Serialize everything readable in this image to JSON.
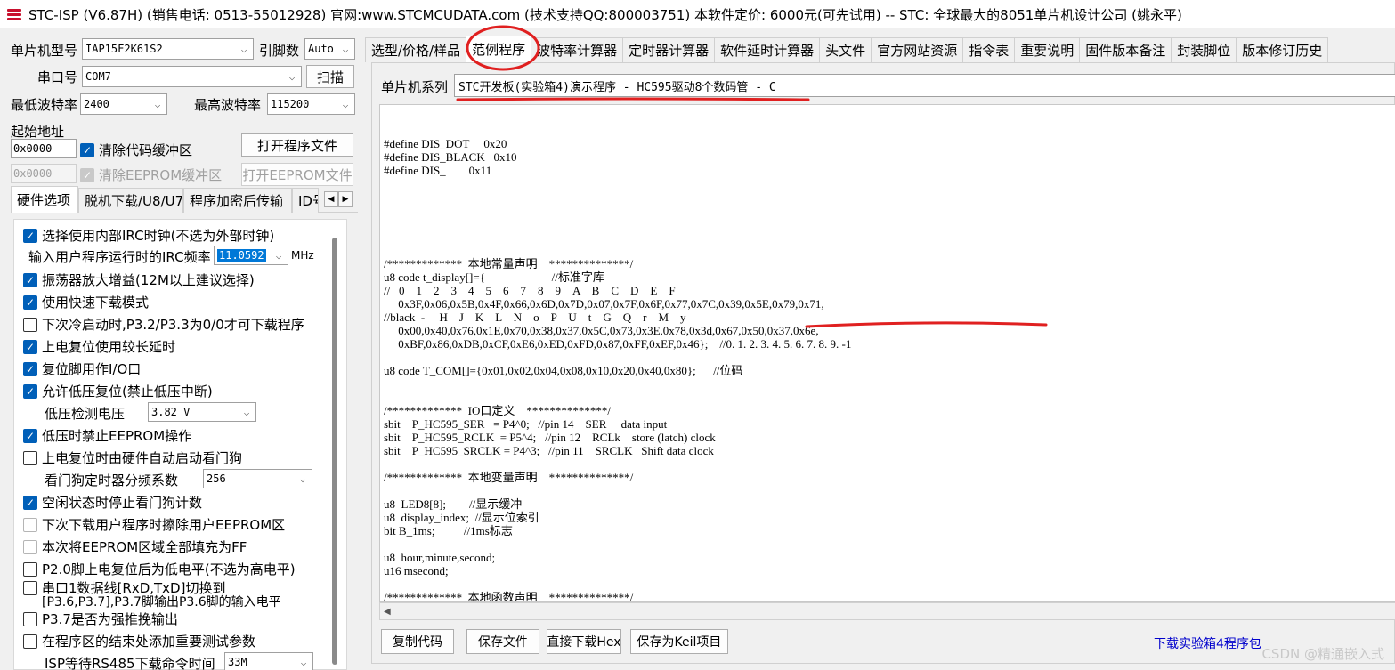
{
  "window": {
    "title": "STC-ISP (V6.87H) (销售电话: 0513-55012928) 官网:www.STCMCUDATA.com  (技术支持QQ:800003751) 本软件定价: 6000元(可先试用) -- STC: 全球最大的8051单片机设计公司 (姚永平)"
  },
  "left": {
    "mcu_model_label": "单片机型号",
    "mcu_model_value": "IAP15F2K61S2",
    "pin_count_label": "引脚数",
    "pin_count_value": "Auto",
    "port_label": "串口号",
    "port_value": "COM7",
    "scan_button": "扫描",
    "min_baud_label": "最低波特率",
    "min_baud_value": "2400",
    "max_baud_label": "最高波特率",
    "max_baud_value": "115200",
    "start_addr_label": "起始地址",
    "code_addr_value": "0x0000",
    "clear_code_buffer": "清除代码缓冲区",
    "open_program_button": "打开程序文件",
    "eeprom_addr_value": "0x0000",
    "clear_eeprom_buffer": "清除EEPROM缓冲区",
    "open_eeprom_button": "打开EEPROM文件",
    "tabs": [
      "硬件选项",
      "脱机下载/U8/U7",
      "程序加密后传输",
      "ID号"
    ],
    "options": {
      "internal_irc": "选择使用内部IRC时钟(不选为外部时钟)",
      "irc_freq_label": "输入用户程序运行时的IRC频率",
      "irc_freq_value": "11.0592",
      "irc_freq_unit": "MHz",
      "osc_gain": "振荡器放大增益(12M以上建议选择)",
      "fast_download": "使用快速下载模式",
      "cold_boot_p32": "下次冷启动时,P3.2/P3.3为0/0才可下载程序",
      "long_delay": "上电复位使用较长延时",
      "reset_io": "复位脚用作I/O口",
      "lvd_reset": "允许低压复位(禁止低压中断)",
      "lvd_voltage_label": "低压检测电压",
      "lvd_voltage_value": "3.82 V",
      "lvd_no_eeprom": "低压时禁止EEPROM操作",
      "wdt_auto": "上电复位时由硬件自动启动看门狗",
      "wdt_div_label": "看门狗定时器分频系数",
      "wdt_div_value": "256",
      "idle_stop_wdt": "空闲状态时停止看门狗计数",
      "erase_eeprom": "下次下载用户程序时擦除用户EEPROM区",
      "fill_eeprom_ff": "本次将EEPROM区域全部填充为FF",
      "p20_low": "P2.0脚上电复位后为低电平(不选为高电平)",
      "uart_switch_1": "串口1数据线[RxD,TxD]切换到",
      "uart_switch_2": "[P3.6,P3.7],P3.7脚输出P3.6脚的输入电平",
      "p37_push_pull": "P3.7是否为强推挽输出",
      "add_test_params": "在程序区的结束处添加重要测试参数",
      "isp_wait_label": "ISP等待RS485下载命令时间",
      "isp_wait_value": "33M"
    }
  },
  "right": {
    "tabs": [
      "选型/价格/样品",
      "范例程序",
      "波特率计算器",
      "定时器计算器",
      "软件延时计算器",
      "头文件",
      "官方网站资源",
      "指令表",
      "重要说明",
      "固件版本备注",
      "封装脚位",
      "版本修订历史"
    ],
    "series_label": "单片机系列",
    "series_value": "STC开发板(实验箱4)演示程序 - HC595驱动8个数码管 - C",
    "code_text": "#define DIS_DOT     0x20\n#define DIS_BLACK   0x10\n#define DIS_        0x11\n\n\n\n\n\n\n/*************  本地常量声明    **************/\nu8 code t_display[]={                       //标准字库\n//   0    1    2    3    4    5    6    7    8    9    A    B    C    D    E    F\n     0x3F,0x06,0x5B,0x4F,0x66,0x6D,0x7D,0x07,0x7F,0x6F,0x77,0x7C,0x39,0x5E,0x79,0x71,\n//black  -     H    J    K    L    N    o    P    U    t    G    Q    r    M    y\n     0x00,0x40,0x76,0x1E,0x70,0x38,0x37,0x5C,0x73,0x3E,0x78,0x3d,0x67,0x50,0x37,0x6e,\n     0xBF,0x86,0xDB,0xCF,0xE6,0xED,0xFD,0x87,0xFF,0xEF,0x46};    //0. 1. 2. 3. 4. 5. 6. 7. 8. 9. -1\n\nu8 code T_COM[]={0x01,0x02,0x04,0x08,0x10,0x20,0x40,0x80};      //位码\n\n\n/*************  IO口定义    **************/\nsbit    P_HC595_SER   = P4^0;   //pin 14    SER     data input\nsbit    P_HC595_RCLK  = P5^4;   //pin 12    RCLk    store (latch) clock\nsbit    P_HC595_SRCLK = P4^3;   //pin 11    SRCLK   Shift data clock\n\n/*************  本地变量声明    **************/\n\nu8  LED8[8];        //显示缓冲\nu8  display_index;  //显示位索引\nbit B_1ms;          //1ms标志\n\nu8  hour,minute,second;\nu16 msecond;\n\n/*************  本地函数声明    **************/\n\n\n/*************  外部函数和变量声明 *****************/",
    "buttons": {
      "copy_code": "复制代码",
      "save_file": "保存文件",
      "direct_download": "直接下载Hex",
      "save_keil": "保存为Keil项目"
    },
    "download_link": "下载实验箱4程序包"
  },
  "watermark": "CSDN @精通嵌入式",
  "colors": {
    "checkbox_blue": "#005fb8",
    "annotation_red": "#e02020",
    "link_blue": "#0000cc"
  }
}
